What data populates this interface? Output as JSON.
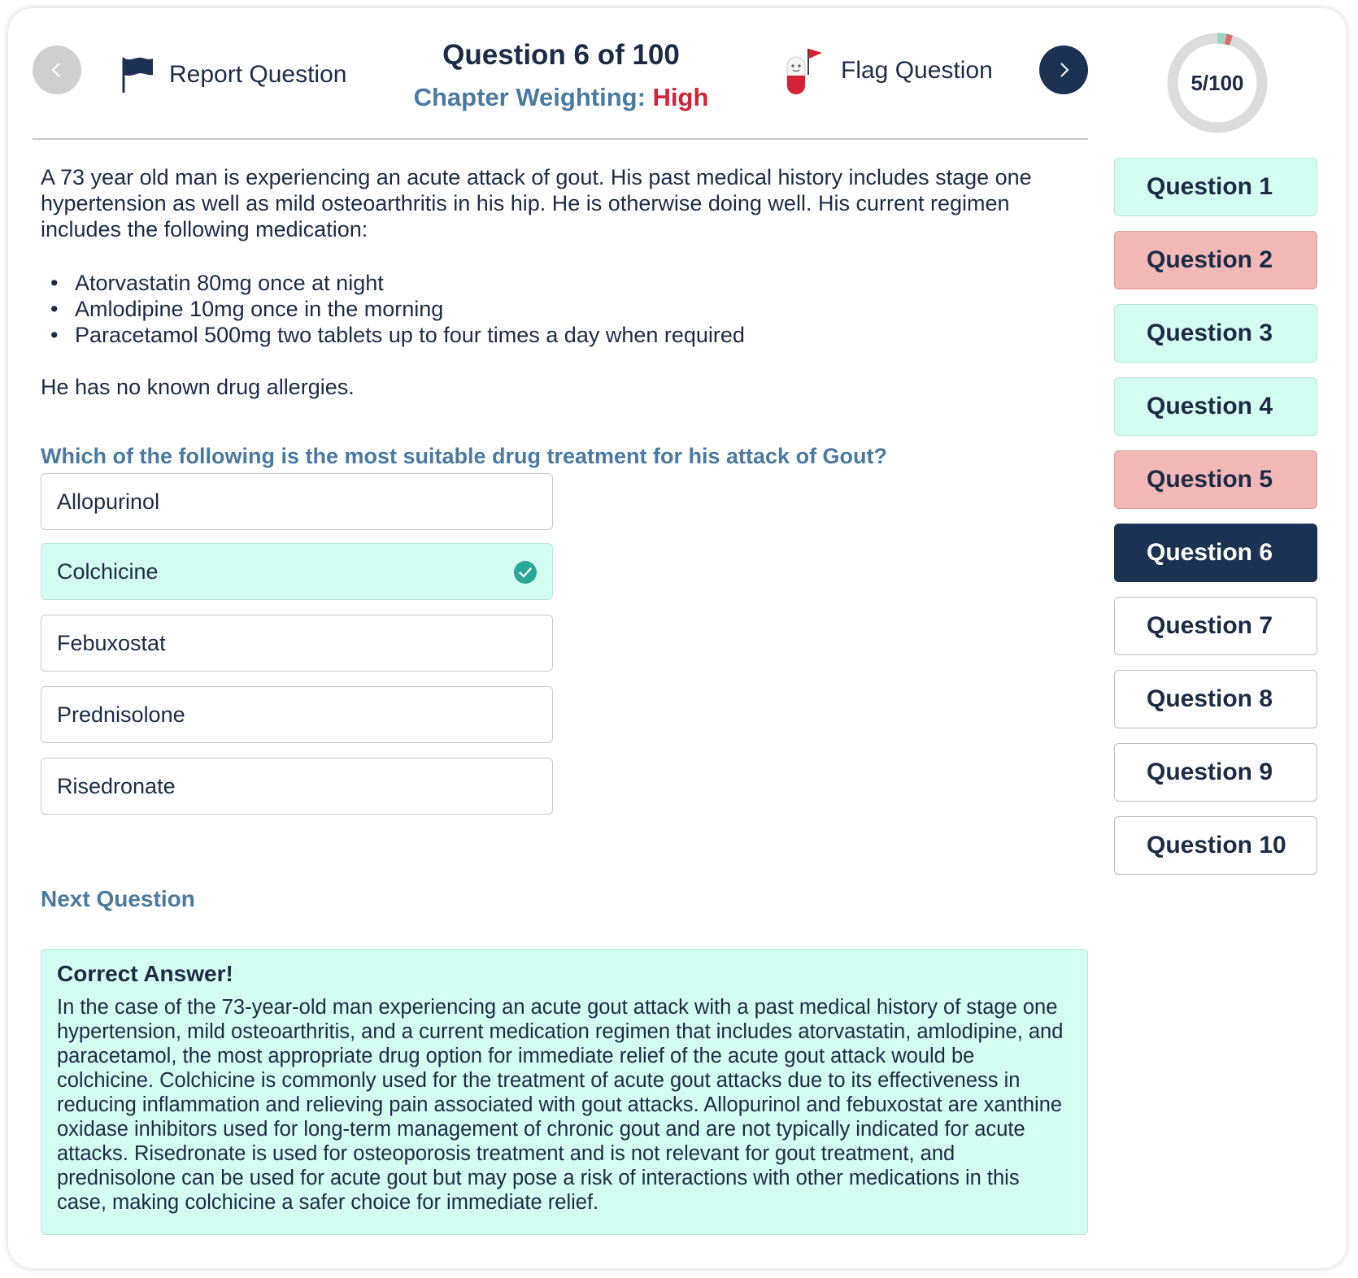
{
  "header": {
    "report_label": "Report Question",
    "flag_label": "Flag Question",
    "question_title": "Question 6 of 100",
    "weighting_label": "Chapter Weighting:",
    "weighting_value": "High"
  },
  "progress": {
    "label": "5/100",
    "answered": 5,
    "total": 100,
    "correct": 3,
    "wrong": 2
  },
  "question": {
    "stem": "A 73 year old man is experiencing an acute attack of gout. His past medical history includes stage one hypertension as well as mild osteoarthritis in his hip. He is otherwise doing well.  His current regimen includes the following medication:",
    "medications": [
      "Atorvastatin 80mg once at night",
      "Amlodipine 10mg once in the morning",
      "Paracetamol 500mg two tablets up to four times a day when required"
    ],
    "bullet": "•",
    "allergies": "He has no known drug allergies.",
    "prompt": "Which of the following is the most suitable drug treatment for his attack of Gout?",
    "options": [
      {
        "label": "Allopurinol",
        "state": "default"
      },
      {
        "label": "Colchicine",
        "state": "correct"
      },
      {
        "label": "Febuxostat",
        "state": "default"
      },
      {
        "label": "Prednisolone",
        "state": "default"
      },
      {
        "label": "Risedronate",
        "state": "default"
      }
    ],
    "next_label": "Next Question"
  },
  "feedback": {
    "title": "Correct Answer!",
    "text": "In the case of the 73-year-old man experiencing an acute gout attack with a past medical history of stage one hypertension, mild osteoarthritis, and a current medication regimen that includes atorvastatin, amlodipine, and paracetamol, the most appropriate drug option for immediate relief of the acute gout attack would be colchicine. Colchicine is commonly used for the treatment of acute gout attacks due to its effectiveness in reducing inflammation and relieving pain associated with gout attacks. Allopurinol and febuxostat are xanthine oxidase inhibitors used for long-term management of chronic gout and are not typically indicated for acute attacks. Risedronate is used for osteoporosis treatment and is not relevant for gout treatment, and prednisolone can be used for acute gout but may pose a risk of interactions with other medications in this case, making colchicine a safer choice for immediate relief."
  },
  "sidebar": {
    "items": [
      {
        "label": "Question 1",
        "state": "correct"
      },
      {
        "label": "Question 2",
        "state": "wrong"
      },
      {
        "label": "Question 3",
        "state": "correct"
      },
      {
        "label": "Question 4",
        "state": "correct"
      },
      {
        "label": "Question 5",
        "state": "wrong"
      },
      {
        "label": "Question 6",
        "state": "current"
      },
      {
        "label": "Question 7",
        "state": "unanswered"
      },
      {
        "label": "Question 8",
        "state": "unanswered"
      },
      {
        "label": "Question 9",
        "state": "unanswered"
      },
      {
        "label": "Question 10",
        "state": "unanswered"
      }
    ]
  },
  "icons": {
    "prev": "chevron-left-icon",
    "next": "chevron-right-icon",
    "report": "flag-icon",
    "flag": "pill-flag-icon",
    "check": "check-circle-icon"
  },
  "colors": {
    "navy": "#1d3153",
    "accent_blue": "#4a7aa1",
    "high_red": "#d42236",
    "correct_bg": "#d2fdf0",
    "wrong_bg": "#f2b8b8",
    "check_teal": "#2aa898",
    "ring_track": "#dcdcdc",
    "ring_correct": "#9fd3c5",
    "ring_wrong": "#e26a6a"
  }
}
